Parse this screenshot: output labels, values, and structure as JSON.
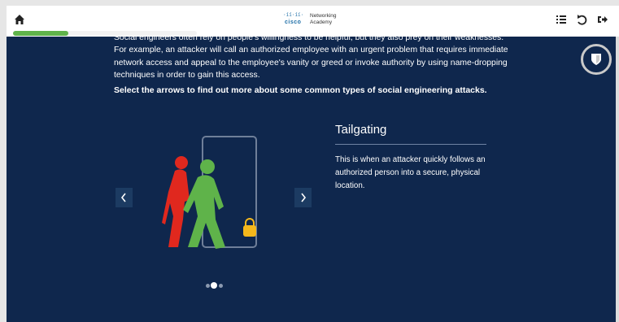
{
  "brand": {
    "bars_glyph": "·íí·íí·",
    "cisco": "cisco",
    "line1": "Networking",
    "line2": "Academy"
  },
  "toolbar": {
    "home_icon": "home-icon",
    "menu_icon": "list-icon",
    "reset_icon": "undo-icon",
    "exit_icon": "exit-icon"
  },
  "progress": {
    "fraction": 0.3,
    "color": "#5fb34a"
  },
  "content": {
    "intro_text": "Social engineers often rely on people's willingness to be helpful, but they also prey on their weaknesses. For example, an attacker will call an authorized employee with an urgent problem that requires immediate network access and appeal to the employee's vanity or greed or invoke authority by using name-dropping techniques in order to gain this access.",
    "instruction": "Select the arrows to find out more about some common types of social engineering attacks."
  },
  "carousel": {
    "title": "Tailgating",
    "description": "This is when an attacker quickly follows an authorized person into a secure, physical location.",
    "current_index": 1,
    "total": 3
  },
  "colors": {
    "background": "#0f274d",
    "person_red": "#e0281e",
    "person_green": "#5fb34a",
    "lock": "#f5b81c"
  }
}
